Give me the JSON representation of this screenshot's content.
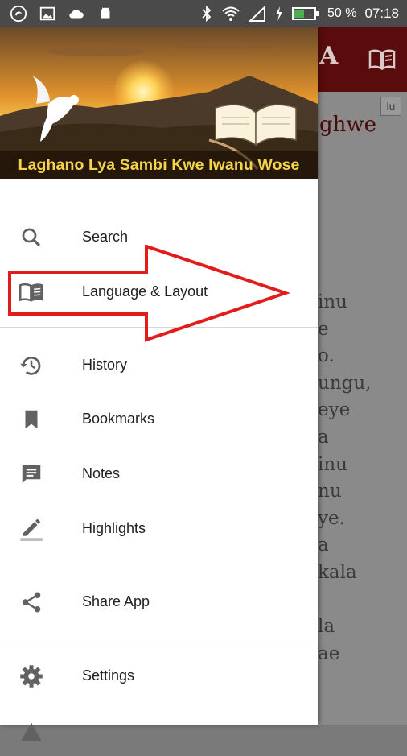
{
  "status_bar": {
    "battery_percent": "50 %",
    "time": "07:18"
  },
  "drawer": {
    "header_title": "Laghano Lya Sambi Kwe Iwanu Wose",
    "items": [
      {
        "label": "Search",
        "icon": "search-icon"
      },
      {
        "label": "Language & Layout",
        "icon": "book-open-icon"
      },
      {
        "label": "History",
        "icon": "history-icon"
      },
      {
        "label": "Bookmarks",
        "icon": "bookmark-icon"
      },
      {
        "label": "Notes",
        "icon": "notes-icon"
      },
      {
        "label": "Highlights",
        "icon": "highlight-pen-icon"
      },
      {
        "label": "Share App",
        "icon": "share-icon"
      },
      {
        "label": "Settings",
        "icon": "settings-icon"
      },
      {
        "label": "",
        "icon": "info-icon"
      }
    ]
  },
  "background_app": {
    "toolbar_title_fragment": "A",
    "badge": "lu",
    "heading_fragment": "ghwe",
    "text_lines": [
      "inu",
      "e",
      "o.",
      "ungu,",
      "eye",
      "a",
      "inu",
      "nu",
      "ye.",
      "a",
      "kala",
      "",
      "la",
      "ae"
    ]
  },
  "colors": {
    "toolbar": "#5a0c0c",
    "annotation_arrow": "#e21b1b",
    "header_title": "#f5d34a"
  }
}
